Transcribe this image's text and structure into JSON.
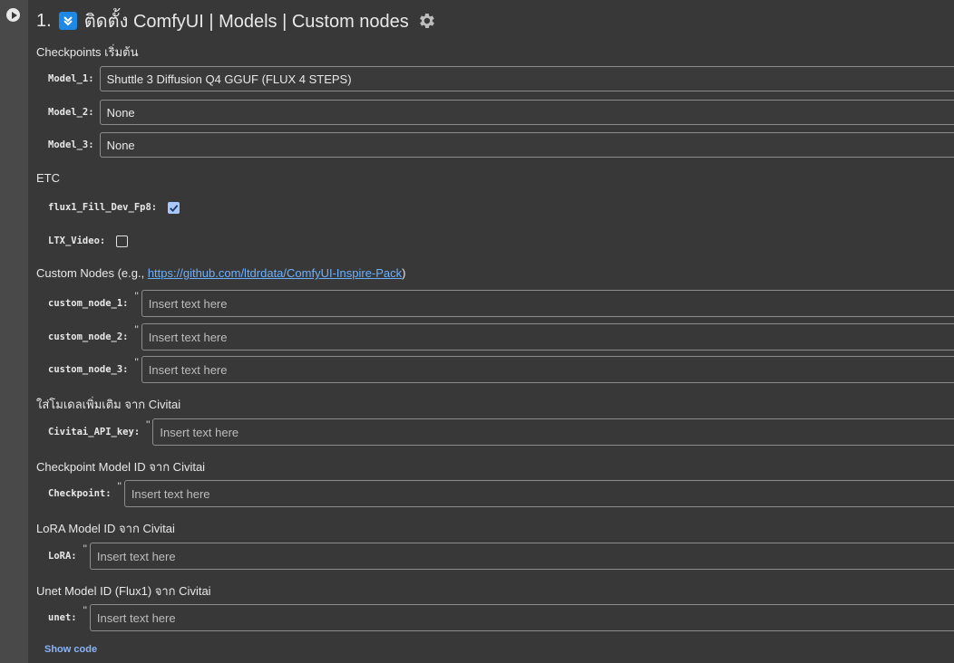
{
  "cell": {
    "title_number": "1.",
    "title_text": "ติดตั้ง ComfyUI | Models | Custom nodes",
    "show_code": "Show code"
  },
  "icons": {
    "run": "play-circle-icon",
    "badge": "double-chevron-down-icon",
    "settings": "gear-icon",
    "check": "checkmark-icon"
  },
  "colors": {
    "badge": "#1e88e5",
    "link": "#6ab0ff",
    "checkbox_on": "#a8c7fa"
  },
  "checkpoints": {
    "heading": "Checkpoints เริ่มต้น",
    "fields": [
      {
        "label": "Model_1:",
        "value": "Shuttle 3 Diffusion Q4 GGUF (FLUX 4 STEPS)"
      },
      {
        "label": "Model_2:",
        "value": "None"
      },
      {
        "label": "Model_3:",
        "value": "None"
      }
    ]
  },
  "etc": {
    "heading": "ETC",
    "fields": [
      {
        "label": "flux1_Fill_Dev_Fp8:",
        "checked": true
      },
      {
        "label": "LTX_Video:",
        "checked": false
      }
    ]
  },
  "custom_nodes": {
    "heading_prefix": "Custom Nodes (e.g., ",
    "heading_link": "https://github.com/ltdrdata/ComfyUI-Inspire-Pack",
    "heading_suffix": ")",
    "fields": [
      {
        "label": "custom_node_1:",
        "placeholder": "Insert text here"
      },
      {
        "label": "custom_node_2:",
        "placeholder": "Insert text here"
      },
      {
        "label": "custom_node_3:",
        "placeholder": "Insert text here"
      }
    ]
  },
  "civitai": {
    "heading": "ใส่โมเดลเพิ่มเติม จาก Civitai",
    "api_key": {
      "label": "Civitai_API_key:",
      "placeholder": "Insert text here"
    }
  },
  "checkpoint_id": {
    "heading": "Checkpoint Model ID จาก Civitai",
    "field": {
      "label": "Checkpoint:",
      "placeholder": "Insert text here"
    }
  },
  "lora_id": {
    "heading": "LoRA Model ID จาก Civitai",
    "field": {
      "label": "LoRA:",
      "placeholder": "Insert text here"
    }
  },
  "unet_id": {
    "heading": "Unet Model ID (Flux1) จาก Civitai",
    "field": {
      "label": "unet:",
      "placeholder": "Insert text here"
    }
  },
  "quote_mark": "\""
}
